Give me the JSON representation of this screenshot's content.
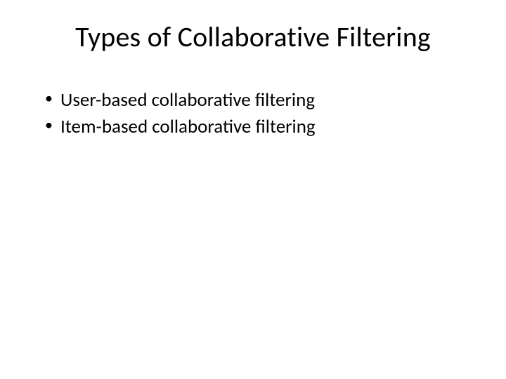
{
  "slide": {
    "title": "Types of Collaborative Filtering",
    "bullets": [
      "User-based collaborative filtering",
      "Item-based collaborative filtering"
    ]
  }
}
